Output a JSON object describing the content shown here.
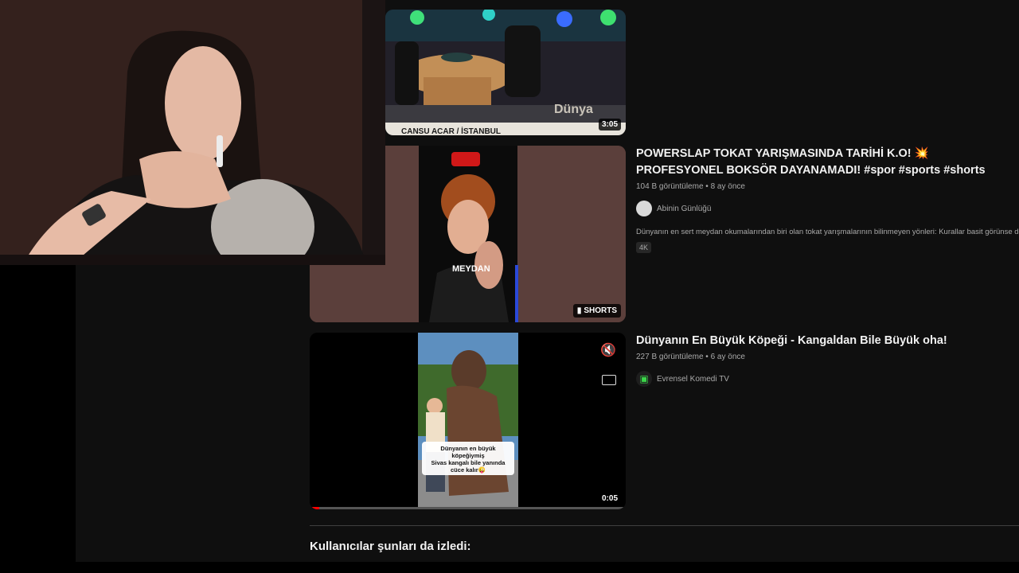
{
  "results": [
    {
      "duration": "3:05",
      "caption_overlay": "CANSU ACAR / İSTANBUL"
    },
    {
      "title": "POWERSLAP TOKAT YARIŞMASINDA TARİHİ K.O! 💥 PROFESYONEL BOKSÖR DAYANAMADI! #spor #sports #shorts",
      "views": "104 B görüntüleme",
      "age": "8 ay önce",
      "channel": "Abinin Günlüğü",
      "description": "Dünyanın en sert meydan okumalarından biri olan tokat yarışmalarının bilinmeyen yönleri: Kurallar basit görünse de...",
      "badge": "4K",
      "shorts_label": "SHORTS",
      "thumb_text": "MEYDAN"
    },
    {
      "title": "Dünyanın En Büyük Köpeği - Kangaldan Bile Büyük oha!",
      "views": "227 B görüntüleme",
      "age": "6 ay önce",
      "channel": "Evrensel Komedi TV",
      "duration": "0:05",
      "thumb_caption": "Dünyanın en büyük köpeğiymiş Sivas kangalı bile yanında cüce kalır😜",
      "progress": 0.03
    }
  ],
  "section_heading": "Kullanıcılar şunları da izledi:",
  "colors": {
    "background": "#0f0f0f",
    "progress": "#ff0000",
    "text_secondary": "#aaaaaa"
  }
}
